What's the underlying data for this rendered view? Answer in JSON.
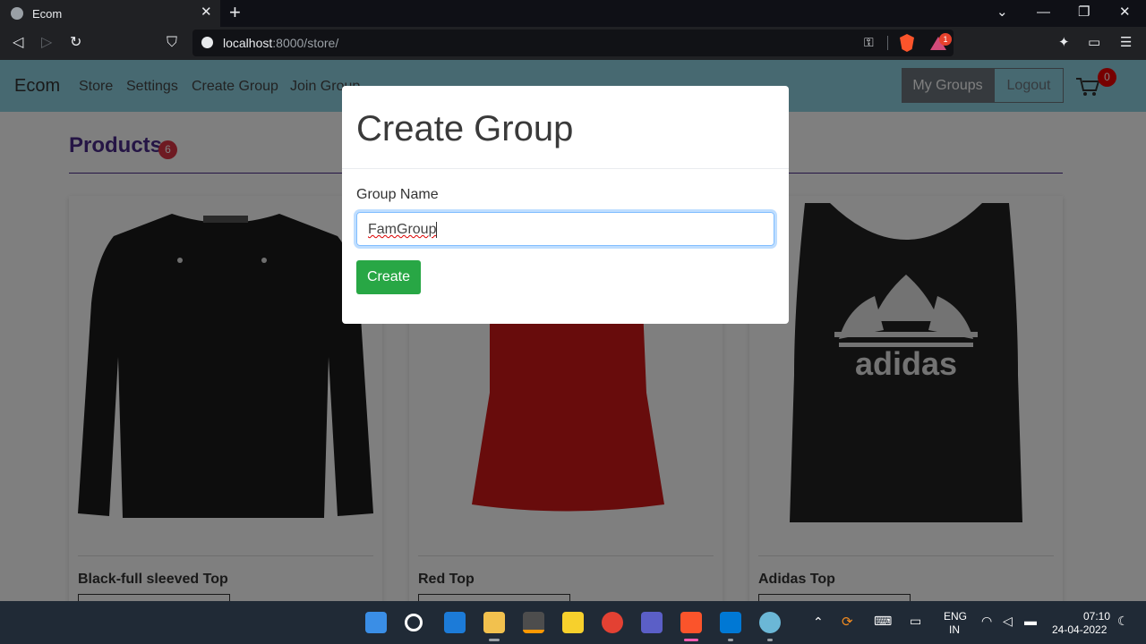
{
  "browser": {
    "tab_title": "Ecom",
    "tab_close": "✕",
    "new_tab": "+",
    "url_host": "localhost",
    "url_rest": ":8000/store/",
    "brave_rewards_badge": "1",
    "win_minimize": "—",
    "win_restore": "❐",
    "win_close": "✕",
    "win_dropdown": "⌄"
  },
  "site": {
    "brand": "Ecom",
    "nav": [
      "Store",
      "Settings",
      "Create Group",
      "Join Group"
    ],
    "my_groups": "My Groups",
    "logout": "Logout",
    "cart_count": "0",
    "products_heading": "Products",
    "products_count": "6",
    "products": [
      {
        "name": "Black-full sleeved Top"
      },
      {
        "name": "Red Top"
      },
      {
        "name": "Adidas Top"
      }
    ]
  },
  "modal": {
    "title": "Create Group",
    "label": "Group Name",
    "input_value": "FamGroup",
    "submit": "Create"
  },
  "taskbar": {
    "lang1": "ENG",
    "lang2": "IN",
    "time": "07:10",
    "date": "24-04-2022"
  },
  "colors": {
    "navbar": "#8ed3e3",
    "products_heading": "#4b2a8a",
    "create_button": "#28a745",
    "badge": "#dc3545"
  }
}
